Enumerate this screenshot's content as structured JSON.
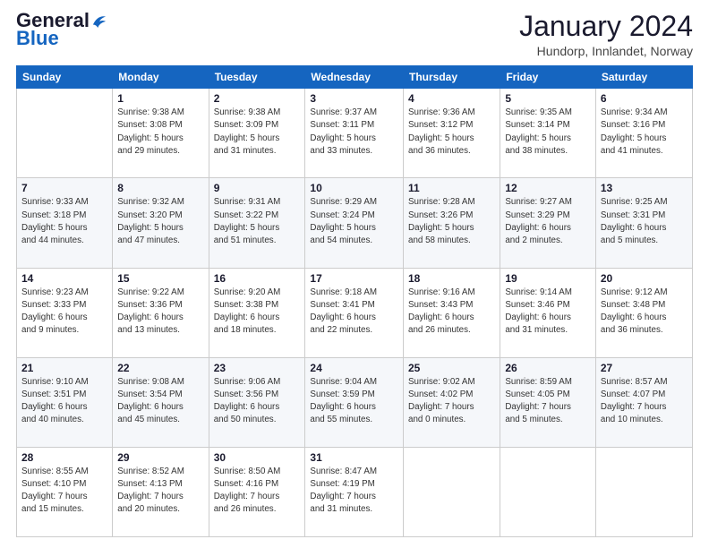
{
  "header": {
    "logo_general": "General",
    "logo_blue": "Blue",
    "month_title": "January 2024",
    "subtitle": "Hundorp, Innlandet, Norway"
  },
  "weekdays": [
    "Sunday",
    "Monday",
    "Tuesday",
    "Wednesday",
    "Thursday",
    "Friday",
    "Saturday"
  ],
  "weeks": [
    [
      {
        "day": "",
        "info": ""
      },
      {
        "day": "1",
        "info": "Sunrise: 9:38 AM\nSunset: 3:08 PM\nDaylight: 5 hours\nand 29 minutes."
      },
      {
        "day": "2",
        "info": "Sunrise: 9:38 AM\nSunset: 3:09 PM\nDaylight: 5 hours\nand 31 minutes."
      },
      {
        "day": "3",
        "info": "Sunrise: 9:37 AM\nSunset: 3:11 PM\nDaylight: 5 hours\nand 33 minutes."
      },
      {
        "day": "4",
        "info": "Sunrise: 9:36 AM\nSunset: 3:12 PM\nDaylight: 5 hours\nand 36 minutes."
      },
      {
        "day": "5",
        "info": "Sunrise: 9:35 AM\nSunset: 3:14 PM\nDaylight: 5 hours\nand 38 minutes."
      },
      {
        "day": "6",
        "info": "Sunrise: 9:34 AM\nSunset: 3:16 PM\nDaylight: 5 hours\nand 41 minutes."
      }
    ],
    [
      {
        "day": "7",
        "info": "Sunrise: 9:33 AM\nSunset: 3:18 PM\nDaylight: 5 hours\nand 44 minutes."
      },
      {
        "day": "8",
        "info": "Sunrise: 9:32 AM\nSunset: 3:20 PM\nDaylight: 5 hours\nand 47 minutes."
      },
      {
        "day": "9",
        "info": "Sunrise: 9:31 AM\nSunset: 3:22 PM\nDaylight: 5 hours\nand 51 minutes."
      },
      {
        "day": "10",
        "info": "Sunrise: 9:29 AM\nSunset: 3:24 PM\nDaylight: 5 hours\nand 54 minutes."
      },
      {
        "day": "11",
        "info": "Sunrise: 9:28 AM\nSunset: 3:26 PM\nDaylight: 5 hours\nand 58 minutes."
      },
      {
        "day": "12",
        "info": "Sunrise: 9:27 AM\nSunset: 3:29 PM\nDaylight: 6 hours\nand 2 minutes."
      },
      {
        "day": "13",
        "info": "Sunrise: 9:25 AM\nSunset: 3:31 PM\nDaylight: 6 hours\nand 5 minutes."
      }
    ],
    [
      {
        "day": "14",
        "info": "Sunrise: 9:23 AM\nSunset: 3:33 PM\nDaylight: 6 hours\nand 9 minutes."
      },
      {
        "day": "15",
        "info": "Sunrise: 9:22 AM\nSunset: 3:36 PM\nDaylight: 6 hours\nand 13 minutes."
      },
      {
        "day": "16",
        "info": "Sunrise: 9:20 AM\nSunset: 3:38 PM\nDaylight: 6 hours\nand 18 minutes."
      },
      {
        "day": "17",
        "info": "Sunrise: 9:18 AM\nSunset: 3:41 PM\nDaylight: 6 hours\nand 22 minutes."
      },
      {
        "day": "18",
        "info": "Sunrise: 9:16 AM\nSunset: 3:43 PM\nDaylight: 6 hours\nand 26 minutes."
      },
      {
        "day": "19",
        "info": "Sunrise: 9:14 AM\nSunset: 3:46 PM\nDaylight: 6 hours\nand 31 minutes."
      },
      {
        "day": "20",
        "info": "Sunrise: 9:12 AM\nSunset: 3:48 PM\nDaylight: 6 hours\nand 36 minutes."
      }
    ],
    [
      {
        "day": "21",
        "info": "Sunrise: 9:10 AM\nSunset: 3:51 PM\nDaylight: 6 hours\nand 40 minutes."
      },
      {
        "day": "22",
        "info": "Sunrise: 9:08 AM\nSunset: 3:54 PM\nDaylight: 6 hours\nand 45 minutes."
      },
      {
        "day": "23",
        "info": "Sunrise: 9:06 AM\nSunset: 3:56 PM\nDaylight: 6 hours\nand 50 minutes."
      },
      {
        "day": "24",
        "info": "Sunrise: 9:04 AM\nSunset: 3:59 PM\nDaylight: 6 hours\nand 55 minutes."
      },
      {
        "day": "25",
        "info": "Sunrise: 9:02 AM\nSunset: 4:02 PM\nDaylight: 7 hours\nand 0 minutes."
      },
      {
        "day": "26",
        "info": "Sunrise: 8:59 AM\nSunset: 4:05 PM\nDaylight: 7 hours\nand 5 minutes."
      },
      {
        "day": "27",
        "info": "Sunrise: 8:57 AM\nSunset: 4:07 PM\nDaylight: 7 hours\nand 10 minutes."
      }
    ],
    [
      {
        "day": "28",
        "info": "Sunrise: 8:55 AM\nSunset: 4:10 PM\nDaylight: 7 hours\nand 15 minutes."
      },
      {
        "day": "29",
        "info": "Sunrise: 8:52 AM\nSunset: 4:13 PM\nDaylight: 7 hours\nand 20 minutes."
      },
      {
        "day": "30",
        "info": "Sunrise: 8:50 AM\nSunset: 4:16 PM\nDaylight: 7 hours\nand 26 minutes."
      },
      {
        "day": "31",
        "info": "Sunrise: 8:47 AM\nSunset: 4:19 PM\nDaylight: 7 hours\nand 31 minutes."
      },
      {
        "day": "",
        "info": ""
      },
      {
        "day": "",
        "info": ""
      },
      {
        "day": "",
        "info": ""
      }
    ]
  ]
}
